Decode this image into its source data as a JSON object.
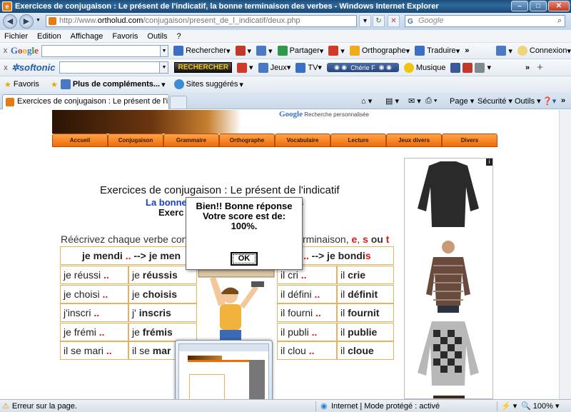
{
  "window": {
    "title": "Exercices de conjugaison : Le présent de l'indicatif, la bonne terminaison des verbes - Windows Internet Explorer",
    "app_icon": "ie-icon"
  },
  "address": {
    "protocol": "http://www.",
    "domain": "ortholud.com",
    "path": "/conjugaison/present_de_l_indicatif/deux.php",
    "search_placeholder": "Google"
  },
  "menu": [
    "Fichier",
    "Edition",
    "Affichage",
    "Favoris",
    "Outils",
    "?"
  ],
  "google_toolbar": {
    "brand": "Google",
    "rechercher": "Rechercher",
    "partager": "Partager",
    "orthographe": "Orthographe",
    "traduire": "Traduire",
    "connexion": "Connexion"
  },
  "softonic_toolbar": {
    "brand": "softonic",
    "search_button": "RECHERCHER",
    "jeux": "Jeux",
    "tv": "TV",
    "radio": "Chérie F",
    "musique": "Musique"
  },
  "favorites_bar": {
    "favoris": "Favoris",
    "plus": "Plus de compléments...",
    "sites": "Sites suggérés"
  },
  "tab": {
    "label": "Exercices de conjugaison : Le présent de l'indicati..."
  },
  "command_bar": {
    "page": "Page",
    "securite": "Sécurité",
    "outils": "Outils"
  },
  "site": {
    "gsearch_brand": "Google",
    "gsearch_label": "Recherche personnalisée",
    "nav": [
      "Accueil",
      "Conjugaison",
      "Grammaire",
      "Orthographe",
      "Vocabulaire",
      "Lecture",
      "Jeux divers",
      "Divers"
    ],
    "title": "Exercices de conjugaison : Le présent de l'indicatif",
    "subtitle_left": "La bonne",
    "subtitle_right": "s",
    "exerc": "Exerc",
    "instruction_left": "Réécrivez chaque verbe con",
    "instruction_right": "rminaison,",
    "instruction_letters": [
      "e",
      "s",
      "t"
    ],
    "instruction_ou": "ou",
    "header_left": "je mendi .. --> je men",
    "header_right": ".. --> je bondis",
    "rows": [
      {
        "q1": "je réussi",
        "a1p": "je",
        "a1": "réussis",
        "q2": "il cri",
        "a2p": "il",
        "a2": "crie"
      },
      {
        "q1": "je choisi",
        "a1p": "je",
        "a1": "choisis",
        "q2": "il défini",
        "a2p": "il",
        "a2": "définit"
      },
      {
        "q1": "j'inscri",
        "a1p": "j'",
        "a1": "inscris",
        "q2": "il fourni",
        "a2p": "il",
        "a2": "fournit"
      },
      {
        "q1": "je frémi",
        "a1p": "je",
        "a1": "frémis",
        "q2": "il publi",
        "a2p": "il",
        "a2": "publie"
      },
      {
        "q1": "il se mari",
        "a1p": "il se",
        "a1": "mar",
        "q2": "il clou",
        "a2p": "il",
        "a2": "cloue"
      }
    ],
    "dots": ".."
  },
  "alert": {
    "line1": "Bien!! Bonne réponse",
    "line2": "Votre score est de:",
    "line3": "100%.",
    "ok": "OK"
  },
  "status": {
    "left": "Erreur sur la page.",
    "zone": "Internet | Mode protégé : activé",
    "zoom": "100%"
  }
}
